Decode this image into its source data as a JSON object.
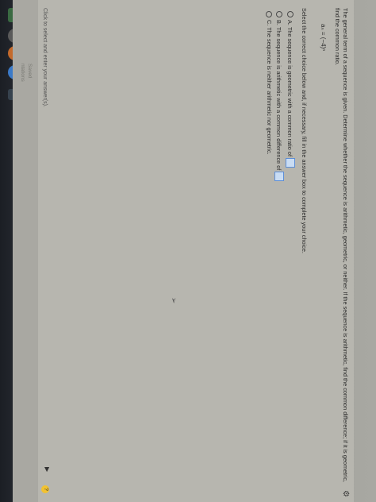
{
  "question": {
    "text": "The general term of a sequence is given. Determine whether the sequence is arithmetic, geometric, or neither. If the sequence is arithmetic, find the common difference; if it is geometric, find the common ratio.",
    "formula": "aₙ = (−4)ⁿ",
    "instruction": "Select the correct choice below and, if necessary, fill in the answer box to complete your choice."
  },
  "choices": [
    {
      "letter": "A.",
      "text": "The sequence is geometric with a common ratio of",
      "has_box": true
    },
    {
      "letter": "B.",
      "text": "The sequence is arithmetic with a common difference of",
      "has_box": true
    },
    {
      "letter": "C.",
      "text": "The sequence is neither arithmetic nor geometric.",
      "has_box": false
    }
  ],
  "footer": {
    "hint": "Click to select and enter your answer(s).",
    "status_1": "Saved",
    "status_2": "ntations"
  },
  "icons": {
    "gear": "gear-icon",
    "help": "help-icon",
    "arrow": "arrow-right-icon",
    "cursor": "mouse-cursor-icon"
  }
}
